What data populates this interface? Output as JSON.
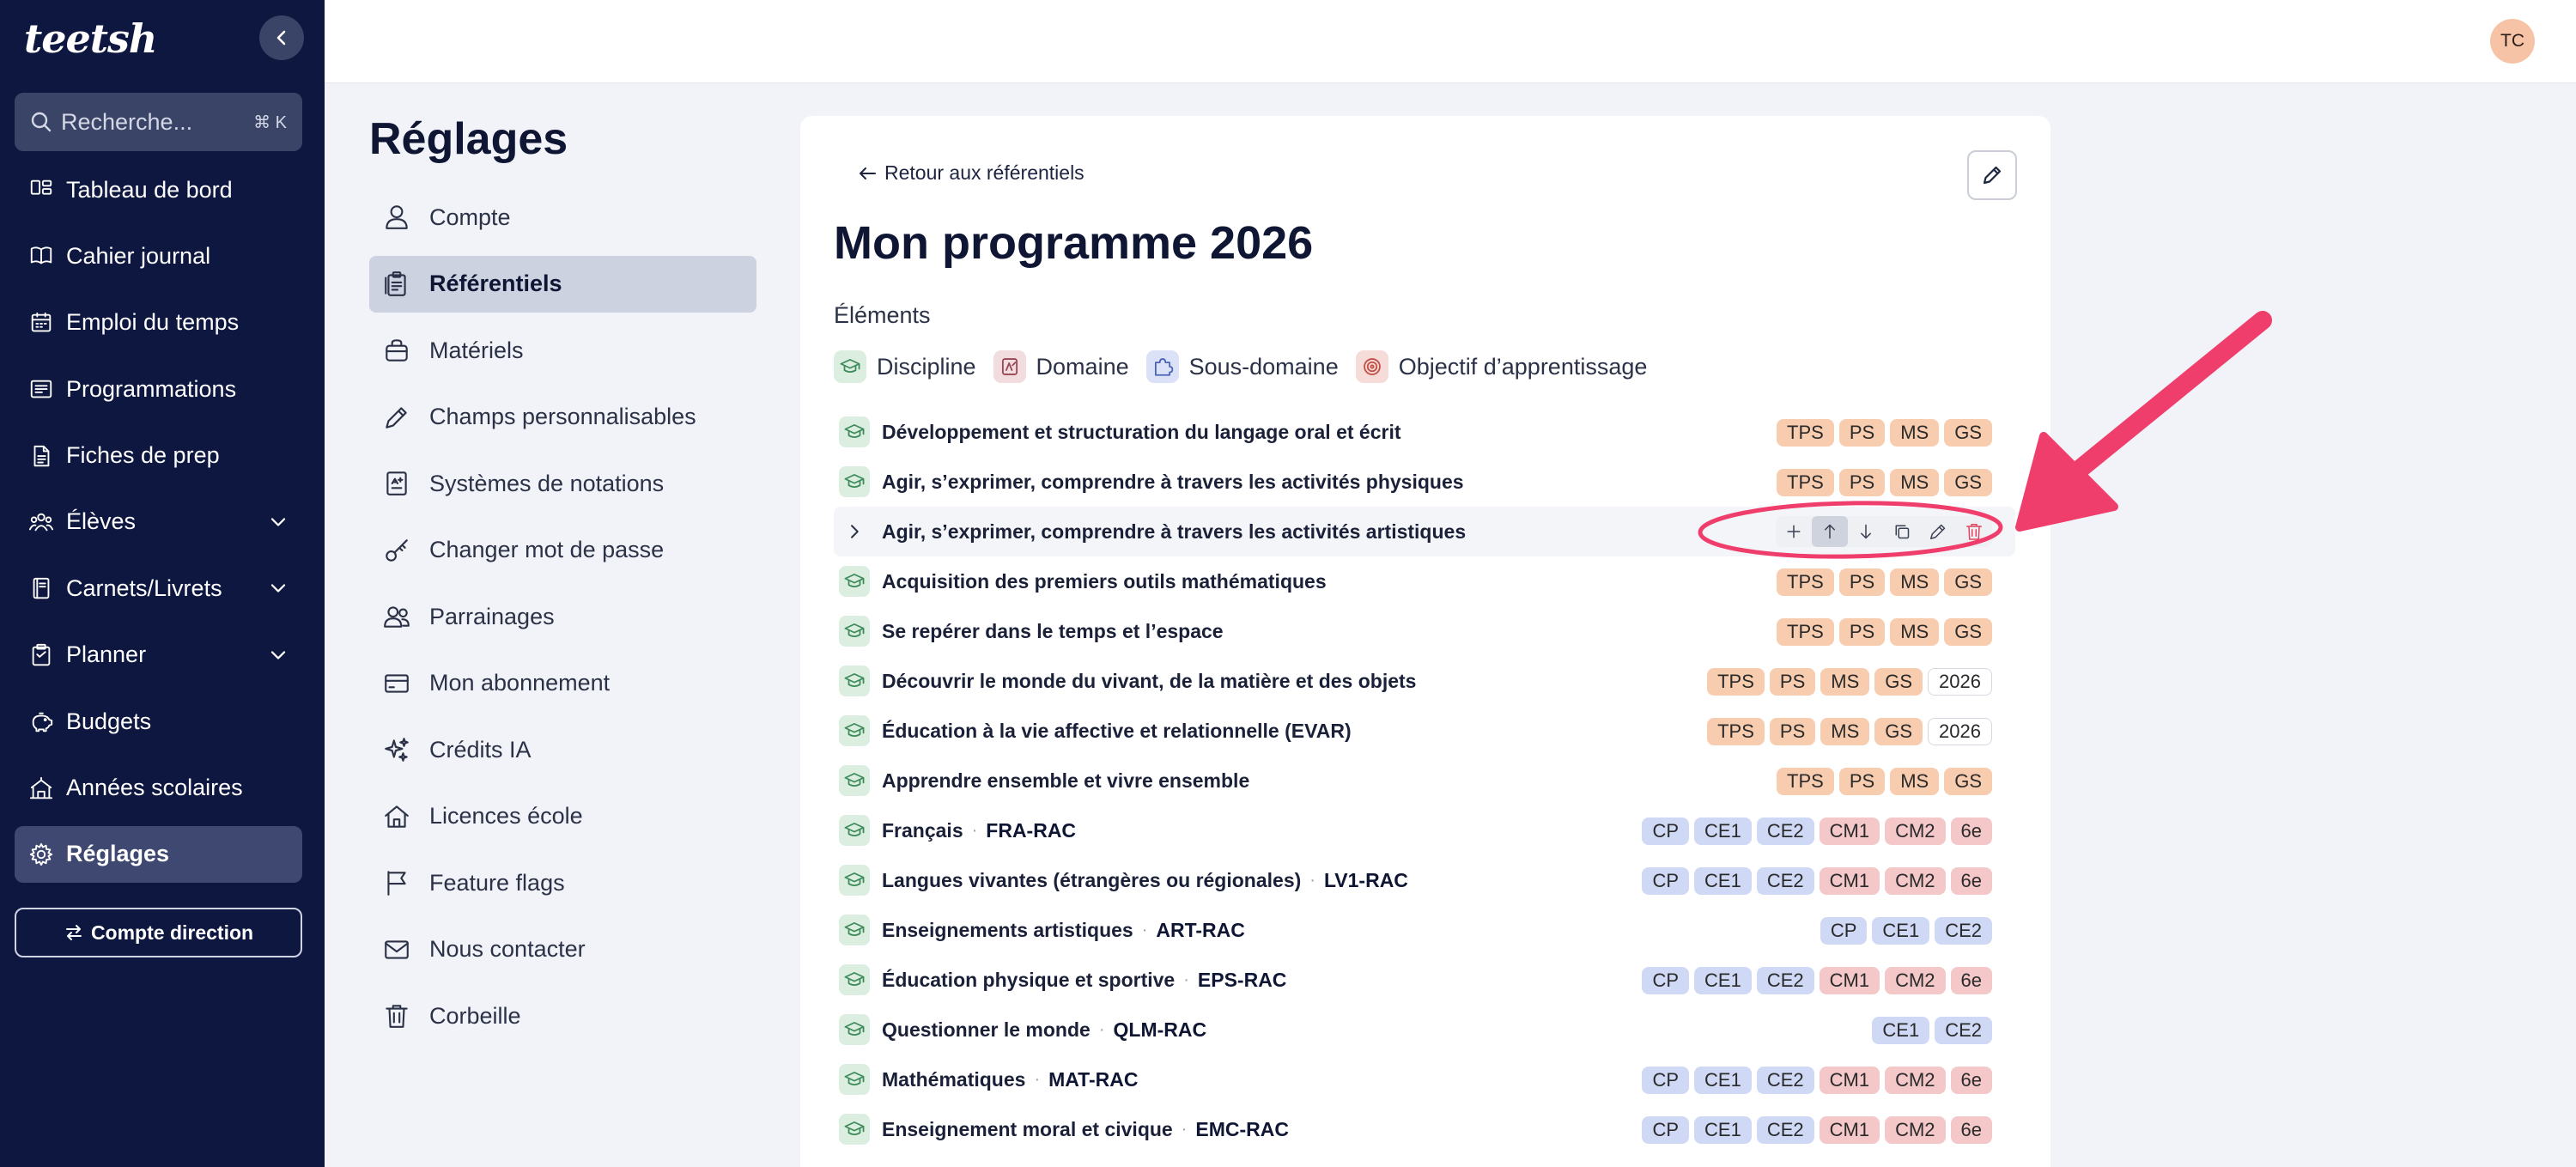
{
  "app": {
    "logo_text": "teetsh",
    "user_initials": "TC"
  },
  "sidebar": {
    "search_placeholder": "Recherche...",
    "search_shortcut": "⌘ K",
    "items": [
      {
        "label": "Tableau de bord",
        "icon": "dashboard-icon"
      },
      {
        "label": "Cahier journal",
        "icon": "book-icon"
      },
      {
        "label": "Emploi du temps",
        "icon": "calendar-icon"
      },
      {
        "label": "Programmations",
        "icon": "list-icon"
      },
      {
        "label": "Fiches de prep",
        "icon": "file-icon"
      },
      {
        "label": "Élèves",
        "icon": "students-icon"
      },
      {
        "label": "Carnets/Livrets",
        "icon": "notebook-icon"
      },
      {
        "label": "Planner",
        "icon": "clipboard-icon"
      },
      {
        "label": "Budgets",
        "icon": "piggy-bank-icon"
      },
      {
        "label": "Années scolaires",
        "icon": "school-icon"
      },
      {
        "label": "Réglages",
        "icon": "gear-icon"
      }
    ],
    "direction_button": "Compte direction"
  },
  "settings": {
    "title": "Réglages",
    "items": [
      {
        "label": "Compte",
        "icon": "user-icon"
      },
      {
        "label": "Référentiels",
        "icon": "clipboard-list-icon"
      },
      {
        "label": "Matériels",
        "icon": "bag-icon"
      },
      {
        "label": "Champs personnalisables",
        "icon": "pencil-icon"
      },
      {
        "label": "Systèmes de notations",
        "icon": "grade-icon"
      },
      {
        "label": "Changer mot de passe",
        "icon": "key-icon"
      },
      {
        "label": "Parrainages",
        "icon": "users-icon"
      },
      {
        "label": "Mon abonnement",
        "icon": "credit-card-icon"
      },
      {
        "label": "Crédits IA",
        "icon": "sparkles-icon"
      },
      {
        "label": "Licences école",
        "icon": "home-icon"
      },
      {
        "label": "Feature flags",
        "icon": "flag-icon"
      },
      {
        "label": "Nous contacter",
        "icon": "mail-icon"
      },
      {
        "label": "Corbeille",
        "icon": "trash-icon"
      }
    ]
  },
  "main": {
    "back_link": "Retour aux référentiels",
    "title": "Mon programme 2026",
    "elements_label": "Éléments",
    "legend": [
      {
        "label": "Discipline",
        "icon": "graduation-cap-icon",
        "bg": "#dceee0"
      },
      {
        "label": "Domaine",
        "icon": "domain-icon",
        "bg": "#f1dde0"
      },
      {
        "label": "Sous-domaine",
        "icon": "puzzle-icon",
        "bg": "#dbe2f7"
      },
      {
        "label": "Objectif d’apprentissage",
        "icon": "target-icon",
        "bg": "#f6dcd8"
      }
    ],
    "rows": [
      {
        "name": "Développement et structuration du langage oral et écrit",
        "code": "",
        "badges": [
          "TPS",
          "PS",
          "MS",
          "GS"
        ]
      },
      {
        "name": "Agir, s’exprimer, comprendre à travers les activités physiques",
        "code": "",
        "badges": [
          "TPS",
          "PS",
          "MS",
          "GS"
        ]
      },
      {
        "name": "Agir, s’exprimer, comprendre à travers les activités artistiques",
        "code": "",
        "badges": [],
        "expandable": true,
        "hovered": true
      },
      {
        "name": "Acquisition des premiers outils mathématiques",
        "code": "",
        "badges": [
          "TPS",
          "PS",
          "MS",
          "GS"
        ]
      },
      {
        "name": "Se repérer dans le temps et l’espace",
        "code": "",
        "badges": [
          "TPS",
          "PS",
          "MS",
          "GS"
        ]
      },
      {
        "name": "Découvrir le monde du vivant, de la matière et des objets",
        "code": "",
        "badges": [
          "TPS",
          "PS",
          "MS",
          "GS",
          "2026"
        ]
      },
      {
        "name": "Éducation à la vie affective et relationnelle (EVAR)",
        "code": "",
        "badges": [
          "TPS",
          "PS",
          "MS",
          "GS",
          "2026"
        ]
      },
      {
        "name": "Apprendre ensemble et vivre ensemble",
        "code": "",
        "badges": [
          "TPS",
          "PS",
          "MS",
          "GS"
        ]
      },
      {
        "name": "Français",
        "code": "FRA-RAC",
        "badges": [
          "CP",
          "CE1",
          "CE2",
          "CM1",
          "CM2",
          "6e"
        ]
      },
      {
        "name": "Langues vivantes (étrangères ou régionales)",
        "code": "LV1-RAC",
        "badges": [
          "CP",
          "CE1",
          "CE2",
          "CM1",
          "CM2",
          "6e"
        ]
      },
      {
        "name": "Enseignements artistiques",
        "code": "ART-RAC",
        "badges": [
          "CP",
          "CE1",
          "CE2"
        ]
      },
      {
        "name": "Éducation physique et sportive",
        "code": "EPS-RAC",
        "badges": [
          "CP",
          "CE1",
          "CE2",
          "CM1",
          "CM2",
          "6e"
        ]
      },
      {
        "name": "Questionner le monde",
        "code": "QLM-RAC",
        "badges": [
          "CE1",
          "CE2"
        ]
      },
      {
        "name": "Mathématiques",
        "code": "MAT-RAC",
        "badges": [
          "CP",
          "CE1",
          "CE2",
          "CM1",
          "CM2",
          "6e"
        ]
      },
      {
        "name": "Enseignement moral et civique",
        "code": "EMC-RAC",
        "badges": [
          "CP",
          "CE1",
          "CE2",
          "CM1",
          "CM2",
          "6e"
        ]
      }
    ],
    "row_actions": [
      "plus-icon",
      "arrow-up-icon",
      "arrow-down-icon",
      "copy-icon",
      "pencil-icon",
      "trash-icon"
    ]
  },
  "colors": {
    "sidebar_bg": "#0d1740",
    "annotation": "#ef3e6b",
    "badge_kinder": "#f8ccae",
    "badge_cycle2": "#cfd9f5",
    "badge_cycle3": "#f4c7c8"
  }
}
